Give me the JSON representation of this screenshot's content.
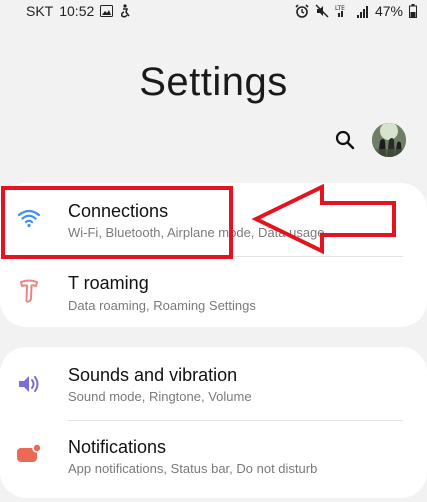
{
  "status_bar": {
    "carrier": "SKT",
    "time": "10:52",
    "battery": "47%",
    "network": "LTE"
  },
  "header": {
    "title": "Settings"
  },
  "icons": {
    "search": "search-icon",
    "avatar": "profile-avatar"
  },
  "groups": [
    {
      "items": [
        {
          "title": "Connections",
          "subtitle": "Wi-Fi, Bluetooth, Airplane mode, Data usage",
          "icon": "wifi-icon",
          "icon_color": "#3d8ff3"
        },
        {
          "title": "T roaming",
          "subtitle": "Data roaming, Roaming Settings",
          "icon": "t-roaming-icon",
          "icon_color": "#e9877f"
        }
      ]
    },
    {
      "items": [
        {
          "title": "Sounds and vibration",
          "subtitle": "Sound mode, Ringtone, Volume",
          "icon": "speaker-icon",
          "icon_color": "#7a6fd8"
        },
        {
          "title": "Notifications",
          "subtitle": "App notifications, Status bar, Do not disturb",
          "icon": "notification-icon",
          "icon_color": "#ec6a55"
        }
      ]
    }
  ],
  "annotation": {
    "color": "#e3141f"
  }
}
